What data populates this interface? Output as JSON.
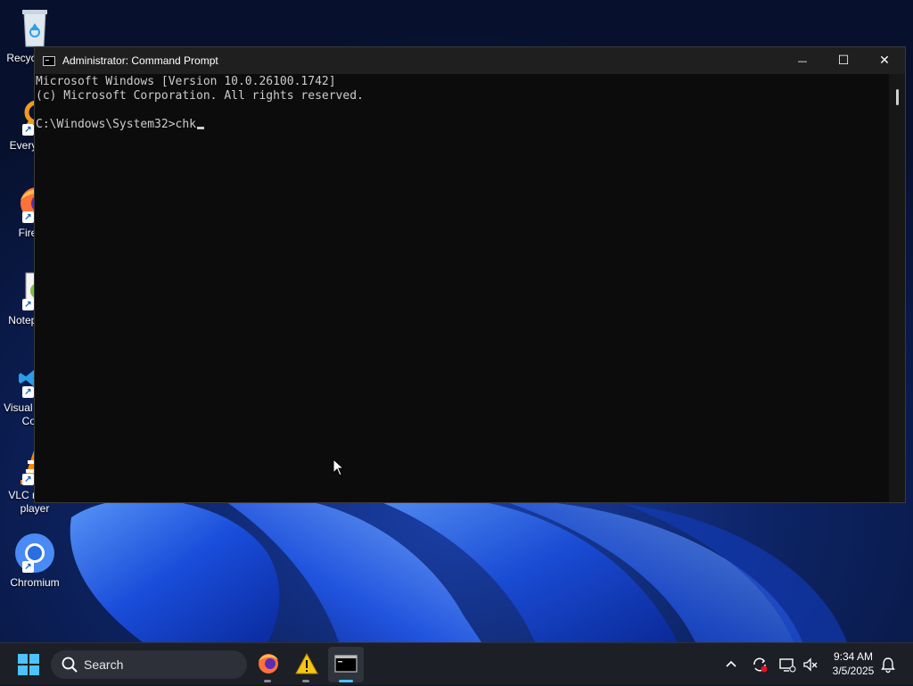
{
  "desktop": {
    "icons": [
      {
        "label": "Recycle Bin",
        "icon": "recycle-bin-icon"
      },
      {
        "label": "Everything",
        "icon": "everything-icon"
      },
      {
        "label": "Firefox",
        "icon": "firefox-icon"
      },
      {
        "label": "Notepad++",
        "icon": "notepad-plus-plus-icon"
      },
      {
        "label": "Visual Studio Code",
        "icon": "vscode-icon"
      },
      {
        "label": "VLC media player",
        "icon": "vlc-icon"
      },
      {
        "label": "Chromium",
        "icon": "chromium-icon"
      }
    ]
  },
  "window": {
    "title": "Administrator: Command Prompt",
    "controls": {
      "minimize": "—",
      "maximize": "☐",
      "close": "✕"
    }
  },
  "console": {
    "lines": [
      "Microsoft Windows [Version 10.0.26100.1742]",
      "(c) Microsoft Corporation. All rights reserved.",
      "",
      "C:\\Windows\\System32>chk"
    ]
  },
  "taskbar": {
    "search_placeholder": "Search",
    "apps": [
      {
        "name": "Firefox",
        "icon": "firefox-icon",
        "active": false
      },
      {
        "name": "Warning app",
        "icon": "warning-icon",
        "active": false
      },
      {
        "name": "Command Prompt",
        "icon": "terminal-icon",
        "active": true
      }
    ],
    "tray": {
      "chevron": "^",
      "time": "9:34 AM",
      "date": "3/5/2025"
    }
  },
  "colors": {
    "accent": "#4cc2ff",
    "console_bg": "#0c0c0c",
    "console_fg": "#cccccc",
    "titlebar": "#1f1f1f",
    "taskbar": "#1c1f26"
  }
}
